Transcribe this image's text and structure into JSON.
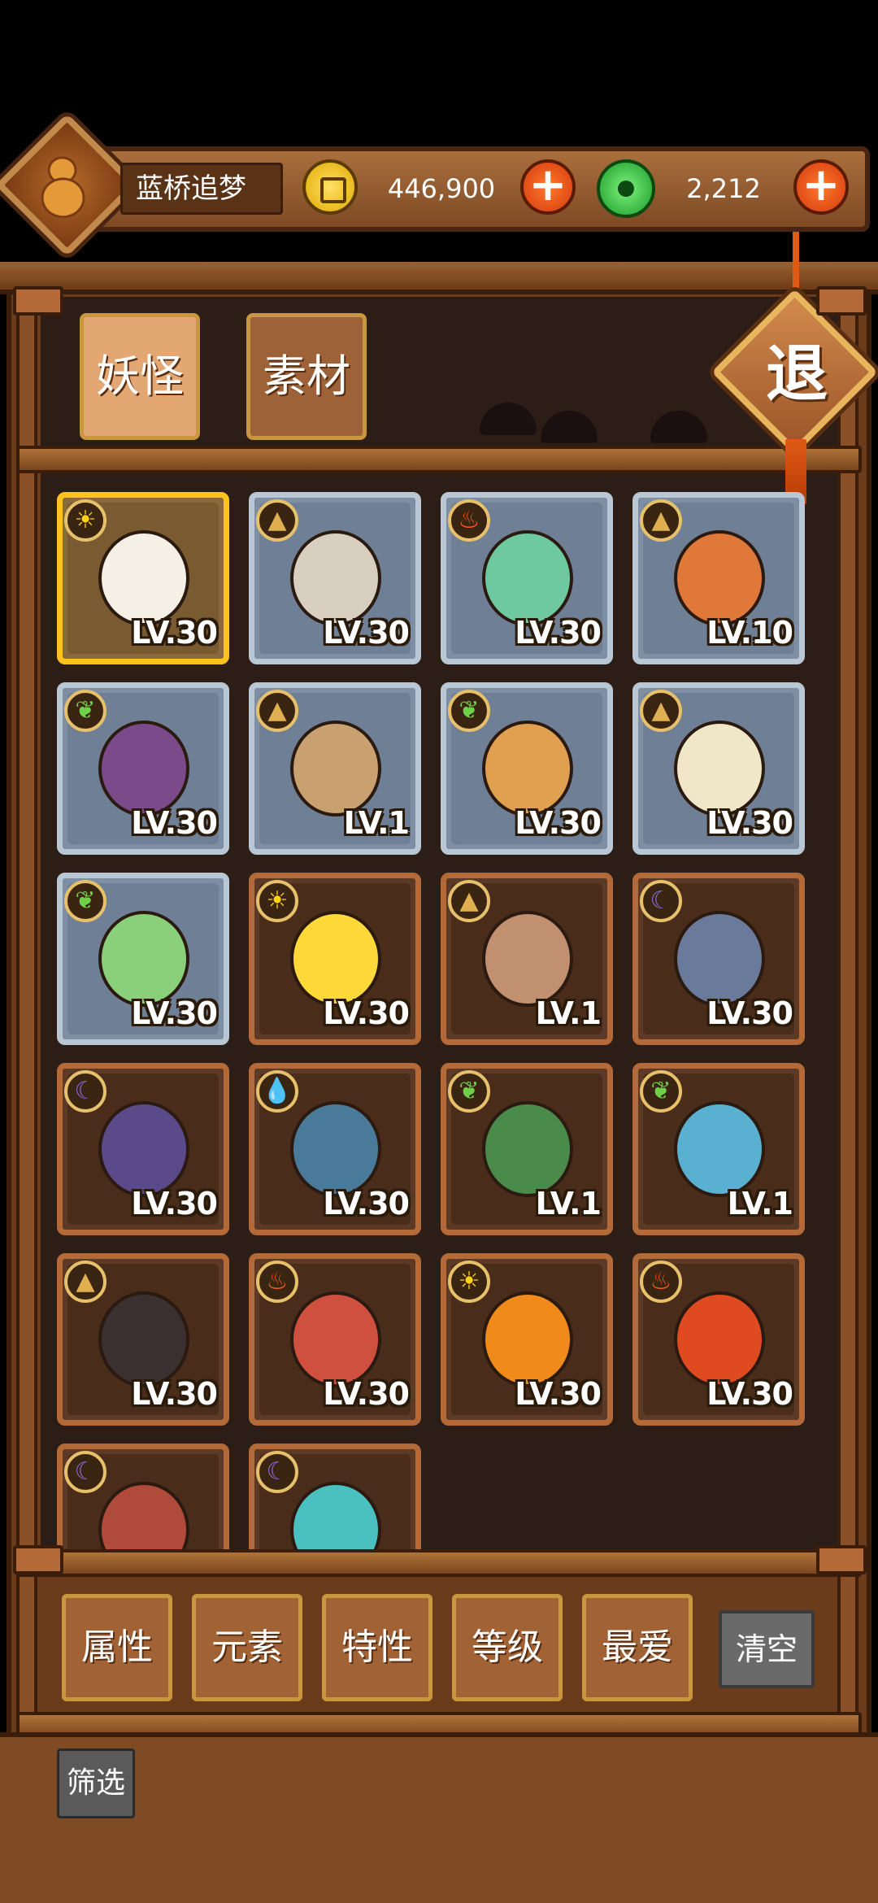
{
  "header": {
    "player_name": "蓝桥追梦",
    "gold": "446,900",
    "jade": "2,212",
    "plus_label": "+"
  },
  "tabs": [
    {
      "label": "妖怪",
      "active": true
    },
    {
      "label": "素材",
      "active": false
    }
  ],
  "exit_label": "退",
  "monsters": [
    {
      "level": "LV.30",
      "element": "sun-icon",
      "frame": "gold"
    },
    {
      "level": "LV.30",
      "element": "earth-icon",
      "frame": "gray"
    },
    {
      "level": "LV.30",
      "element": "fire-icon",
      "frame": "gray"
    },
    {
      "level": "LV.10",
      "element": "earth-icon",
      "frame": "gray"
    },
    {
      "level": "LV.30",
      "element": "leaf-icon",
      "frame": "gray"
    },
    {
      "level": "LV.1",
      "element": "earth-icon",
      "frame": "gray"
    },
    {
      "level": "LV.30",
      "element": "leaf-icon",
      "frame": "gray"
    },
    {
      "level": "LV.30",
      "element": "earth-icon",
      "frame": "gray"
    },
    {
      "level": "LV.30",
      "element": "leaf-icon",
      "frame": "gray"
    },
    {
      "level": "LV.30",
      "element": "sun-icon",
      "frame": "brown"
    },
    {
      "level": "LV.1",
      "element": "earth-icon",
      "frame": "brown"
    },
    {
      "level": "LV.30",
      "element": "moon-icon",
      "frame": "brown"
    },
    {
      "level": "LV.30",
      "element": "moon-icon",
      "frame": "brown"
    },
    {
      "level": "LV.30",
      "element": "water-icon",
      "frame": "brown"
    },
    {
      "level": "LV.1",
      "element": "leaf-icon",
      "frame": "brown"
    },
    {
      "level": "LV.1",
      "element": "leaf-icon",
      "frame": "brown"
    },
    {
      "level": "LV.30",
      "element": "earth-icon",
      "frame": "brown"
    },
    {
      "level": "LV.30",
      "element": "fire-icon",
      "frame": "brown"
    },
    {
      "level": "LV.30",
      "element": "sun-icon",
      "frame": "brown"
    },
    {
      "level": "LV.30",
      "element": "fire-icon",
      "frame": "brown"
    },
    {
      "level": "",
      "element": "moon-icon",
      "frame": "brown"
    },
    {
      "level": "",
      "element": "moon-icon",
      "frame": "brown"
    }
  ],
  "filters": [
    "属性",
    "元素",
    "特性",
    "等级",
    "最爱"
  ],
  "clear_label": "清空",
  "filter_label": "筛选",
  "colors": {
    "wood": "#6b3c1c",
    "gold_frame": "#ffc21e",
    "gray_frame": "#b9c6d4",
    "brown_frame": "#b36a38"
  }
}
